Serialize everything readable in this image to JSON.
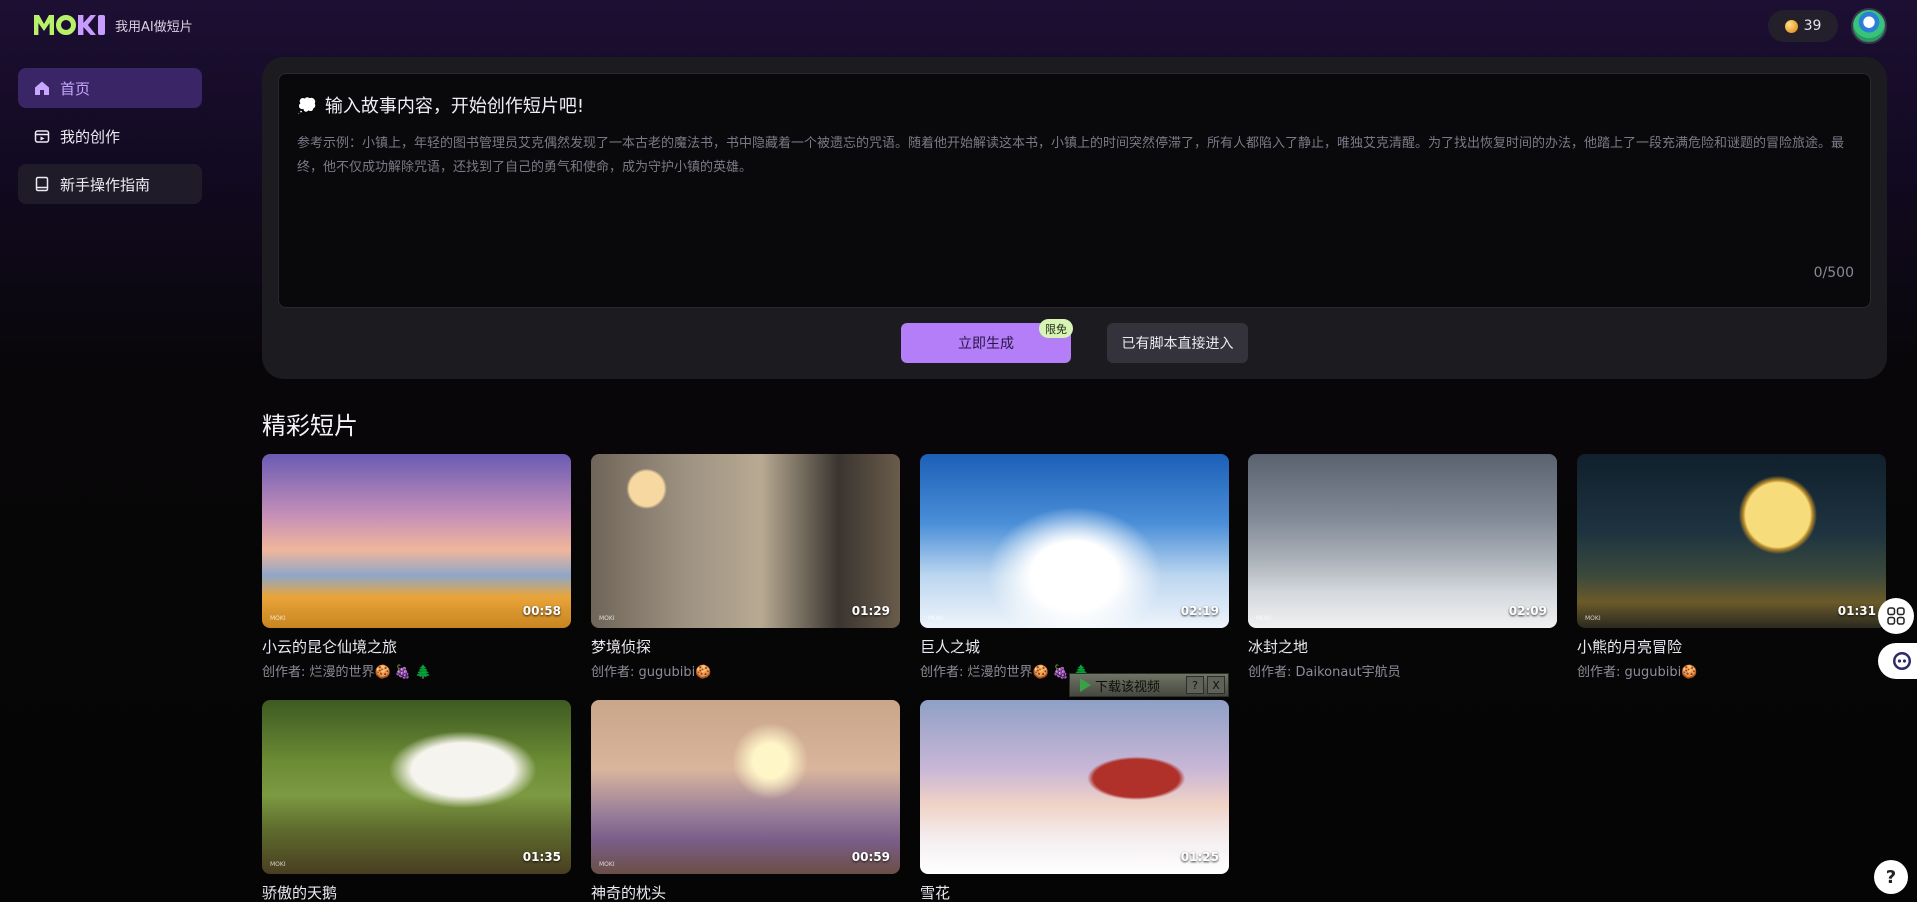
{
  "header": {
    "logo_text": "我用AI做短片",
    "coins": "39"
  },
  "sidebar": {
    "items": [
      {
        "label": "首页",
        "icon": "home-icon"
      },
      {
        "label": "我的创作",
        "icon": "film-icon"
      },
      {
        "label": "新手操作指南",
        "icon": "book-icon"
      }
    ]
  },
  "composer": {
    "title": "输入故事内容，开始创作短片吧!",
    "placeholder": "参考示例：小镇上，年轻的图书管理员艾克偶然发现了一本古老的魔法书，书中隐藏着一个被遗忘的咒语。随着他开始解读这本书，小镇上的时间突然停滞了，所有人都陷入了静止，唯独艾克清醒。为了找出恢复时间的办法，他踏上了一段充满危险和谜题的冒险旅途。最终，他不仅成功解除咒语，还找到了自己的勇气和使命，成为守护小镇的英雄。",
    "char_count": "0/500",
    "generate_label": "立即生成",
    "free_badge": "限免",
    "script_label": "已有脚本直接进入"
  },
  "gallery": {
    "title": "精彩短片",
    "videos": [
      {
        "title": "小云的昆仑仙境之旅",
        "author": "创作者: 烂漫的世界🍪 🍇 🌲",
        "duration": "00:58"
      },
      {
        "title": "梦境侦探",
        "author": "创作者: gugubibi🍪",
        "duration": "01:29"
      },
      {
        "title": "巨人之城",
        "author": "创作者: 烂漫的世界🍪 🍇 🌲",
        "duration": "02:19"
      },
      {
        "title": "冰封之地",
        "author": "创作者: Daikonaut宇航员",
        "duration": "02:09"
      },
      {
        "title": "小熊的月亮冒险",
        "author": "创作者: gugubibi🍪",
        "duration": "01:31"
      },
      {
        "title": "骄傲的天鹅",
        "author": "",
        "duration": "01:35"
      },
      {
        "title": "神奇的枕头",
        "author": "",
        "duration": "00:59"
      },
      {
        "title": "雪花",
        "author": "",
        "duration": "01:25"
      }
    ]
  },
  "download_overlay": {
    "label": "下载该视频",
    "help": "?",
    "close": "X"
  },
  "floating": {
    "help": "?"
  }
}
